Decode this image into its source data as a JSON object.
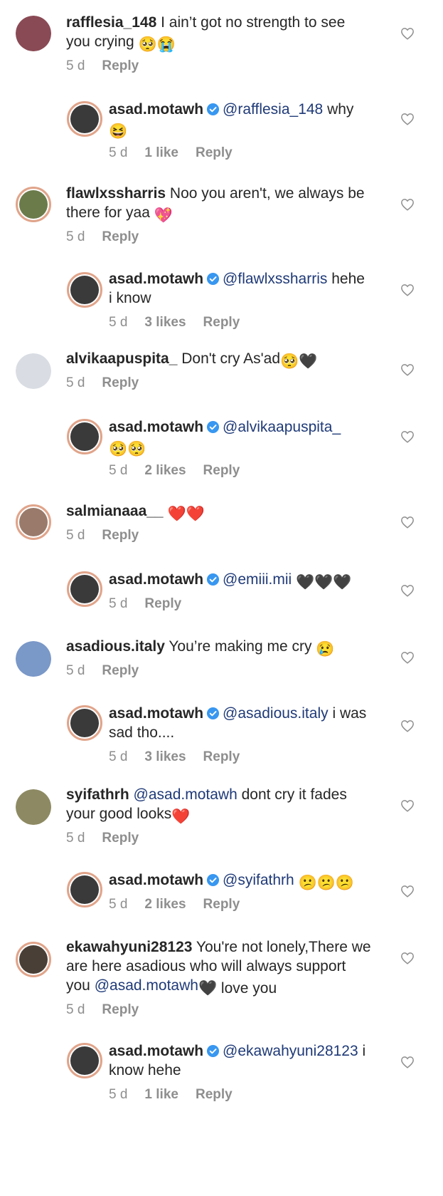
{
  "comments": [
    {
      "user": "rafflesia_148",
      "text_before": " I ain’t got no strength to see you crying ",
      "mention": "",
      "text_after": "",
      "emoji": "🥺😭",
      "time": "5 d",
      "likes": "",
      "reply": "Reply",
      "reply_level": 0
    },
    {
      "user": "asad.motawh",
      "text_before": " ",
      "mention": "@rafflesia_148",
      "text_after": " why ",
      "emoji": "😆",
      "time": "5 d",
      "likes": "1 like",
      "reply": "Reply",
      "reply_level": 1
    },
    {
      "user": "flawlxssharris",
      "text_before": " Noo you aren't, we always be there for yaa ",
      "mention": "",
      "text_after": "",
      "emoji": "💖",
      "time": "5 d",
      "likes": "",
      "reply": "Reply",
      "reply_level": 0
    },
    {
      "user": "asad.motawh",
      "text_before": " ",
      "mention": "@flawlxssharris",
      "text_after": " hehe i know",
      "emoji": "",
      "time": "5 d",
      "likes": "3 likes",
      "reply": "Reply",
      "reply_level": 1
    },
    {
      "user": "alvikaapuspita_",
      "text_before": " Don't cry As'ad",
      "mention": "",
      "text_after": "",
      "emoji": "🥺🖤",
      "time": "5 d",
      "likes": "",
      "reply": "Reply",
      "reply_level": 0
    },
    {
      "user": "asad.motawh",
      "text_before": " ",
      "mention": "@alvikaapuspita_",
      "text_after": " ",
      "emoji": "🥺🥺",
      "time": "5 d",
      "likes": "2 likes",
      "reply": "Reply",
      "reply_level": 1
    },
    {
      "user": "salmianaaa__",
      "text_before": " ",
      "mention": "",
      "text_after": "",
      "emoji": "❤️❤️",
      "time": "5 d",
      "likes": "",
      "reply": "Reply",
      "reply_level": 0
    },
    {
      "user": "asad.motawh",
      "text_before": " ",
      "mention": "@emiii.mii",
      "text_after": " ",
      "emoji": "🖤🖤🖤",
      "time": "5 d",
      "likes": "",
      "reply": "Reply",
      "reply_level": 1
    },
    {
      "user": "asadious.italy",
      "text_before": " You’re making me cry ",
      "mention": "",
      "text_after": "",
      "emoji": "😢",
      "time": "5 d",
      "likes": "",
      "reply": "Reply",
      "reply_level": 0
    },
    {
      "user": "asad.motawh",
      "text_before": " ",
      "mention": "@asadious.italy",
      "text_after": " i was sad tho....",
      "emoji": "",
      "time": "5 d",
      "likes": "3 likes",
      "reply": "Reply",
      "reply_level": 1
    },
    {
      "user": "syifathrh",
      "text_before": " ",
      "mention": "@asad.motawh",
      "text_after": " dont cry it fades your good looks",
      "emoji": "❤️",
      "time": "5 d",
      "likes": "",
      "reply": "Reply",
      "reply_level": 0
    },
    {
      "user": "asad.motawh",
      "text_before": " ",
      "mention": "@syifathrh",
      "text_after": " ",
      "emoji": "😕😕😕",
      "time": "5 d",
      "likes": "2 likes",
      "reply": "Reply",
      "reply_level": 1
    },
    {
      "user": "ekawahyuni28123",
      "text_before": " You're not lonely,There we are here asadious who will always support you ",
      "mention": "@asad.motawh",
      "text_after": "",
      "emoji": "🖤 love you ",
      "time": "5 d",
      "likes": "",
      "reply": "Reply",
      "reply_level": 0
    },
    {
      "user": "asad.motawh",
      "text_before": " ",
      "mention": "@ekawahyuni28123",
      "text_after": " i know hehe",
      "emoji": "",
      "time": "5 d",
      "likes": "1 like",
      "reply": "Reply",
      "reply_level": 1
    }
  ],
  "colors": {
    "mention": "#1f3a78",
    "muted": "#8e8e8e",
    "verified": "#3897f0",
    "ring": "#e0a48a"
  }
}
